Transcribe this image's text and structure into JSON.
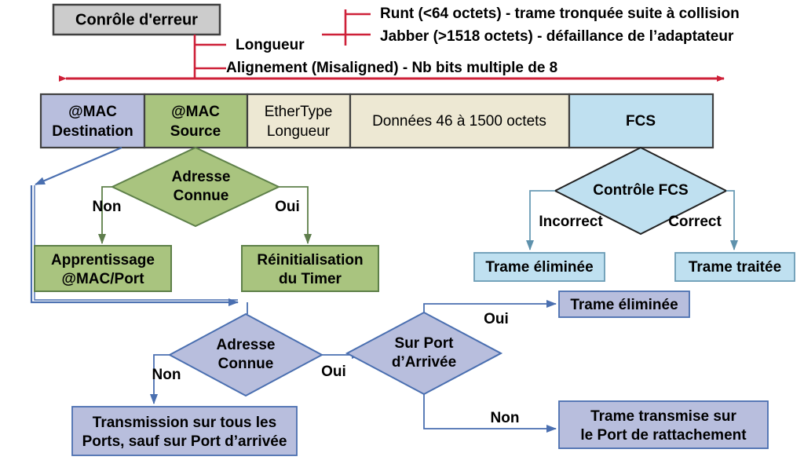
{
  "title_box": {
    "label": "Conrôle d'erreur"
  },
  "error_control": {
    "branch_label": "Longueur",
    "items": [
      "Runt (<64 octets) - trame tronquée suite à collision",
      "Jabber (>1518 octets) - défaillance de l’adaptateur",
      "Alignement (Misaligned) - Nb bits multiple de 8"
    ]
  },
  "frame": {
    "fields": [
      {
        "line1": "@MAC",
        "line2": "Destination",
        "bold": true
      },
      {
        "line1": "@MAC",
        "line2": "Source",
        "bold": true
      },
      {
        "line1": "EtherType",
        "line2": "Longueur",
        "bold": false
      },
      {
        "line1": "Données 46 à 1500 octets",
        "line2": "",
        "bold": false
      },
      {
        "line1": "FCS",
        "line2": "",
        "bold": true
      }
    ]
  },
  "decisions": {
    "adresse_connue_src": {
      "line1": "Adresse",
      "line2": "Connue"
    },
    "controle_fcs": {
      "line1": "Contrôle FCS",
      "line2": ""
    },
    "adresse_connue_dst": {
      "line1": "Adresse",
      "line2": "Connue"
    },
    "sur_port_arrivee": {
      "line1": "Sur Port",
      "line2": "d’Arrivée"
    }
  },
  "edge_labels": {
    "src_non": "Non",
    "src_oui": "Oui",
    "fcs_incorrect": "Incorrect",
    "fcs_correct": "Correct",
    "dst_non": "Non",
    "dst_oui": "Oui",
    "port_oui": "Oui",
    "port_non": "Non"
  },
  "actions": {
    "apprentissage": {
      "line1": "Apprentissage",
      "line2": "@MAC/Port"
    },
    "reinitialisation": {
      "line1": "Réinitialisation",
      "line2": "du Timer"
    },
    "trame_eliminee_fcs": {
      "line1": "Trame éliminée",
      "line2": ""
    },
    "trame_traitee": {
      "line1": "Trame traitée",
      "line2": ""
    },
    "trame_eliminee_port": {
      "line1": "Trame éliminée",
      "line2": ""
    },
    "transmission_tous": {
      "line1": "Transmission sur tous les",
      "line2": "Ports, sauf sur Port d’arrivée"
    },
    "trame_transmise": {
      "line1": "Trame transmise sur",
      "line2": "le Port de rattachement"
    }
  },
  "colors": {
    "red": "#CE2038",
    "blue_fill": "#B8BEDD",
    "blue_stroke": "#4A5FA5",
    "green_fill": "#A9C47F",
    "green_stroke": "#5E8049",
    "cream_fill": "#EDE8D3",
    "cyan_fill": "#BFE0F0",
    "cyan_stroke": "#6A9BB5",
    "gray_fill": "#CCCCCC",
    "dark_stroke": "#404040"
  }
}
